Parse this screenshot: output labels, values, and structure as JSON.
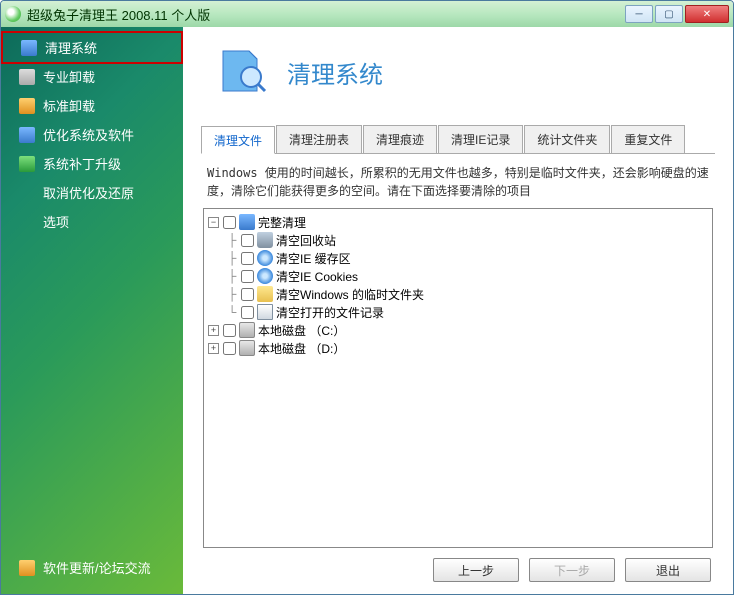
{
  "window": {
    "title": "超级兔子清理王 2008.11 个人版"
  },
  "sidebar": {
    "items": [
      {
        "label": "清理系统",
        "icon": "cleanup"
      },
      {
        "label": "专业卸载",
        "icon": "uninstall-pro"
      },
      {
        "label": "标准卸载",
        "icon": "uninstall-std"
      },
      {
        "label": "优化系统及软件",
        "icon": "optimize"
      },
      {
        "label": "系统补丁升级",
        "icon": "patch"
      },
      {
        "label": "取消优化及还原",
        "icon": ""
      },
      {
        "label": "选项",
        "icon": ""
      }
    ],
    "bottom": {
      "label": "软件更新/论坛交流",
      "icon": "update"
    }
  },
  "header": {
    "title": "清理系统"
  },
  "tabs": [
    {
      "label": "清理文件",
      "active": true
    },
    {
      "label": "清理注册表",
      "active": false
    },
    {
      "label": "清理痕迹",
      "active": false
    },
    {
      "label": "清理IE记录",
      "active": false
    },
    {
      "label": "统计文件夹",
      "active": false
    },
    {
      "label": "重复文件",
      "active": false
    }
  ],
  "description": "Windows 使用的时间越长，所累积的无用文件也越多，特别是临时文件夹，还会影响硬盘的速度，清除它们能获得更多的空间。请在下面选择要清除的项目",
  "tree": [
    {
      "label": "完整清理",
      "icon": "magnify",
      "level": 0,
      "expander": "-",
      "checked": false
    },
    {
      "label": "清空回收站",
      "icon": "trash",
      "level": 1,
      "expander": "",
      "checked": false
    },
    {
      "label": "清空IE 缓存区",
      "icon": "ie",
      "level": 1,
      "expander": "",
      "checked": false
    },
    {
      "label": "清空IE Cookies",
      "icon": "ie",
      "level": 1,
      "expander": "",
      "checked": false
    },
    {
      "label": "清空Windows 的临时文件夹",
      "icon": "folder",
      "level": 1,
      "expander": "",
      "checked": false
    },
    {
      "label": "清空打开的文件记录",
      "icon": "doc",
      "level": 1,
      "expander": "",
      "checked": false
    },
    {
      "label": "本地磁盘 （C:）",
      "icon": "disk",
      "level": 0,
      "expander": "+",
      "checked": false
    },
    {
      "label": "本地磁盘 （D:）",
      "icon": "disk-d",
      "level": 0,
      "expander": "+",
      "checked": false
    }
  ],
  "buttons": {
    "prev": "上一步",
    "next": "下一步",
    "exit": "退出"
  }
}
